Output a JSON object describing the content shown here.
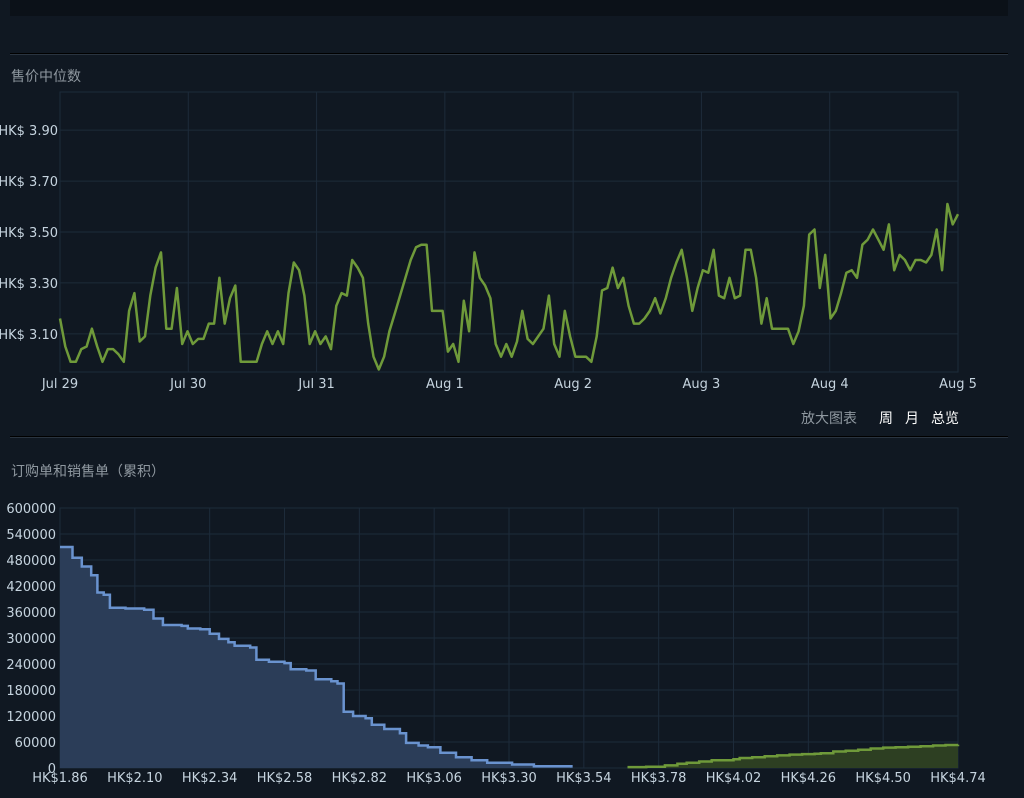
{
  "median_section": {
    "title": "售价中位数"
  },
  "zoom": {
    "label": "放大图表",
    "week": "周",
    "month": "月",
    "overview": "总览"
  },
  "orders_section": {
    "title": "订购单和销售单（累积）"
  },
  "colors": {
    "price_line": "#6f9a3a",
    "buy": "#6a93cf",
    "buy_fill": "#2b3d58",
    "sell": "#6f9a3a",
    "sell_fill": "#2d3f22",
    "grid": "#1d2b3a"
  },
  "chart_data": [
    {
      "type": "line",
      "x": [
        "Jul 29",
        "Jul 30",
        "Jul 31",
        "Aug 1",
        "Aug 2",
        "Aug 3",
        "Aug 4",
        "Aug 5"
      ],
      "ylim": [
        2.95,
        4.05
      ],
      "yticks": [
        "HK$ 3.10",
        "HK$ 3.30",
        "HK$ 3.50",
        "HK$ 3.70",
        "HK$ 3.90"
      ],
      "ytick_values": [
        3.1,
        3.3,
        3.5,
        3.7,
        3.9
      ],
      "series": [
        {
          "values": [
            3.16,
            3.05,
            2.99,
            2.99,
            3.04,
            3.05,
            3.12,
            3.05,
            2.99,
            3.04,
            3.04,
            3.02,
            2.99,
            3.19,
            3.26,
            3.07,
            3.09,
            3.25,
            3.36,
            3.42,
            3.12,
            3.12,
            3.28,
            3.06,
            3.11,
            3.06,
            3.08,
            3.08,
            3.14,
            3.14,
            3.32,
            3.14,
            3.24,
            3.29,
            2.99,
            2.99,
            2.99,
            2.99,
            3.06,
            3.11,
            3.06,
            3.11,
            3.06,
            3.26,
            3.38,
            3.35,
            3.25,
            3.06,
            3.11,
            3.06,
            3.09,
            3.04,
            3.21,
            3.26,
            3.25,
            3.39,
            3.36,
            3.32,
            3.14,
            3.01,
            2.96,
            3.01,
            3.11,
            3.18,
            3.25,
            3.32,
            3.39,
            3.44,
            3.45,
            3.45,
            3.19,
            3.19,
            3.19,
            3.03,
            3.06,
            2.99,
            3.23,
            3.11,
            3.42,
            3.32,
            3.29,
            3.24,
            3.06,
            3.01,
            3.06,
            3.01,
            3.07,
            3.19,
            3.08,
            3.06,
            3.09,
            3.12,
            3.25,
            3.06,
            3.01,
            3.19,
            3.09,
            3.01,
            3.01,
            3.01,
            2.99,
            3.09,
            3.27,
            3.28,
            3.36,
            3.28,
            3.32,
            3.21,
            3.14,
            3.14,
            3.16,
            3.19,
            3.24,
            3.18,
            3.24,
            3.32,
            3.38,
            3.43,
            3.32,
            3.19,
            3.28,
            3.35,
            3.34,
            3.43,
            3.25,
            3.24,
            3.32,
            3.24,
            3.25,
            3.43,
            3.43,
            3.32,
            3.14,
            3.24,
            3.12,
            3.12,
            3.12,
            3.12,
            3.06,
            3.11,
            3.21,
            3.49,
            3.51,
            3.28,
            3.41,
            3.16,
            3.19,
            3.26,
            3.34,
            3.35,
            3.32,
            3.45,
            3.47,
            3.51,
            3.47,
            3.43,
            3.53,
            3.35,
            3.41,
            3.39,
            3.35,
            3.39,
            3.39,
            3.38,
            3.41,
            3.51,
            3.35,
            3.61,
            3.53,
            3.57
          ]
        }
      ]
    },
    {
      "type": "area",
      "xlim": [
        1.86,
        4.74
      ],
      "ylim": [
        0,
        600000
      ],
      "xticks": [
        "HK$1.86",
        "HK$2.10",
        "HK$2.34",
        "HK$2.58",
        "HK$2.82",
        "HK$3.06",
        "HK$3.30",
        "HK$3.54",
        "HK$3.78",
        "HK$4.02",
        "HK$4.26",
        "HK$4.50",
        "HK$4.74"
      ],
      "xtick_values": [
        1.86,
        2.1,
        2.34,
        2.58,
        2.82,
        3.06,
        3.3,
        3.54,
        3.78,
        4.02,
        4.26,
        4.5,
        4.74
      ],
      "yticks": [
        "0",
        "60000",
        "120000",
        "180000",
        "240000",
        "300000",
        "360000",
        "420000",
        "480000",
        "540000",
        "600000"
      ],
      "ytick_values": [
        0,
        60000,
        120000,
        180000,
        240000,
        300000,
        360000,
        420000,
        480000,
        540000,
        600000
      ],
      "series": [
        {
          "points": [
            [
              1.86,
              510000
            ],
            [
              1.9,
              485000
            ],
            [
              1.93,
              465000
            ],
            [
              1.96,
              445000
            ],
            [
              1.98,
              405000
            ],
            [
              2.0,
              400000
            ],
            [
              2.02,
              370000
            ],
            [
              2.07,
              368000
            ],
            [
              2.13,
              365000
            ],
            [
              2.16,
              345000
            ],
            [
              2.19,
              330000
            ],
            [
              2.25,
              328000
            ],
            [
              2.27,
              322000
            ],
            [
              2.31,
              320000
            ],
            [
              2.34,
              310000
            ],
            [
              2.37,
              298000
            ],
            [
              2.4,
              290000
            ],
            [
              2.42,
              282000
            ],
            [
              2.47,
              278000
            ],
            [
              2.49,
              250000
            ],
            [
              2.53,
              245000
            ],
            [
              2.58,
              242000
            ],
            [
              2.6,
              228000
            ],
            [
              2.65,
              225000
            ],
            [
              2.68,
              205000
            ],
            [
              2.73,
              200000
            ],
            [
              2.75,
              195000
            ],
            [
              2.77,
              130000
            ],
            [
              2.8,
              120000
            ],
            [
              2.84,
              115000
            ],
            [
              2.86,
              100000
            ],
            [
              2.9,
              90000
            ],
            [
              2.95,
              80000
            ],
            [
              2.97,
              58000
            ],
            [
              3.01,
              52000
            ],
            [
              3.04,
              48000
            ],
            [
              3.08,
              35000
            ],
            [
              3.13,
              25000
            ],
            [
              3.18,
              18000
            ],
            [
              3.23,
              12000
            ],
            [
              3.31,
              8000
            ],
            [
              3.38,
              4000
            ],
            [
              3.5,
              1000
            ]
          ]
        },
        {
          "points": [
            [
              3.68,
              2000
            ],
            [
              3.74,
              3000
            ],
            [
              3.8,
              6000
            ],
            [
              3.84,
              10000
            ],
            [
              3.87,
              12000
            ],
            [
              3.91,
              15000
            ],
            [
              3.95,
              18000
            ],
            [
              4.02,
              20000
            ],
            [
              4.04,
              23000
            ],
            [
              4.08,
              25000
            ],
            [
              4.12,
              27000
            ],
            [
              4.16,
              29000
            ],
            [
              4.2,
              31000
            ],
            [
              4.24,
              32000
            ],
            [
              4.28,
              33000
            ],
            [
              4.3,
              34000
            ],
            [
              4.34,
              38000
            ],
            [
              4.38,
              40000
            ],
            [
              4.42,
              42000
            ],
            [
              4.46,
              45000
            ],
            [
              4.5,
              47000
            ],
            [
              4.54,
              48000
            ],
            [
              4.58,
              49000
            ],
            [
              4.62,
              50000
            ],
            [
              4.66,
              52000
            ],
            [
              4.7,
              53000
            ],
            [
              4.74,
              54000
            ]
          ]
        }
      ]
    }
  ]
}
